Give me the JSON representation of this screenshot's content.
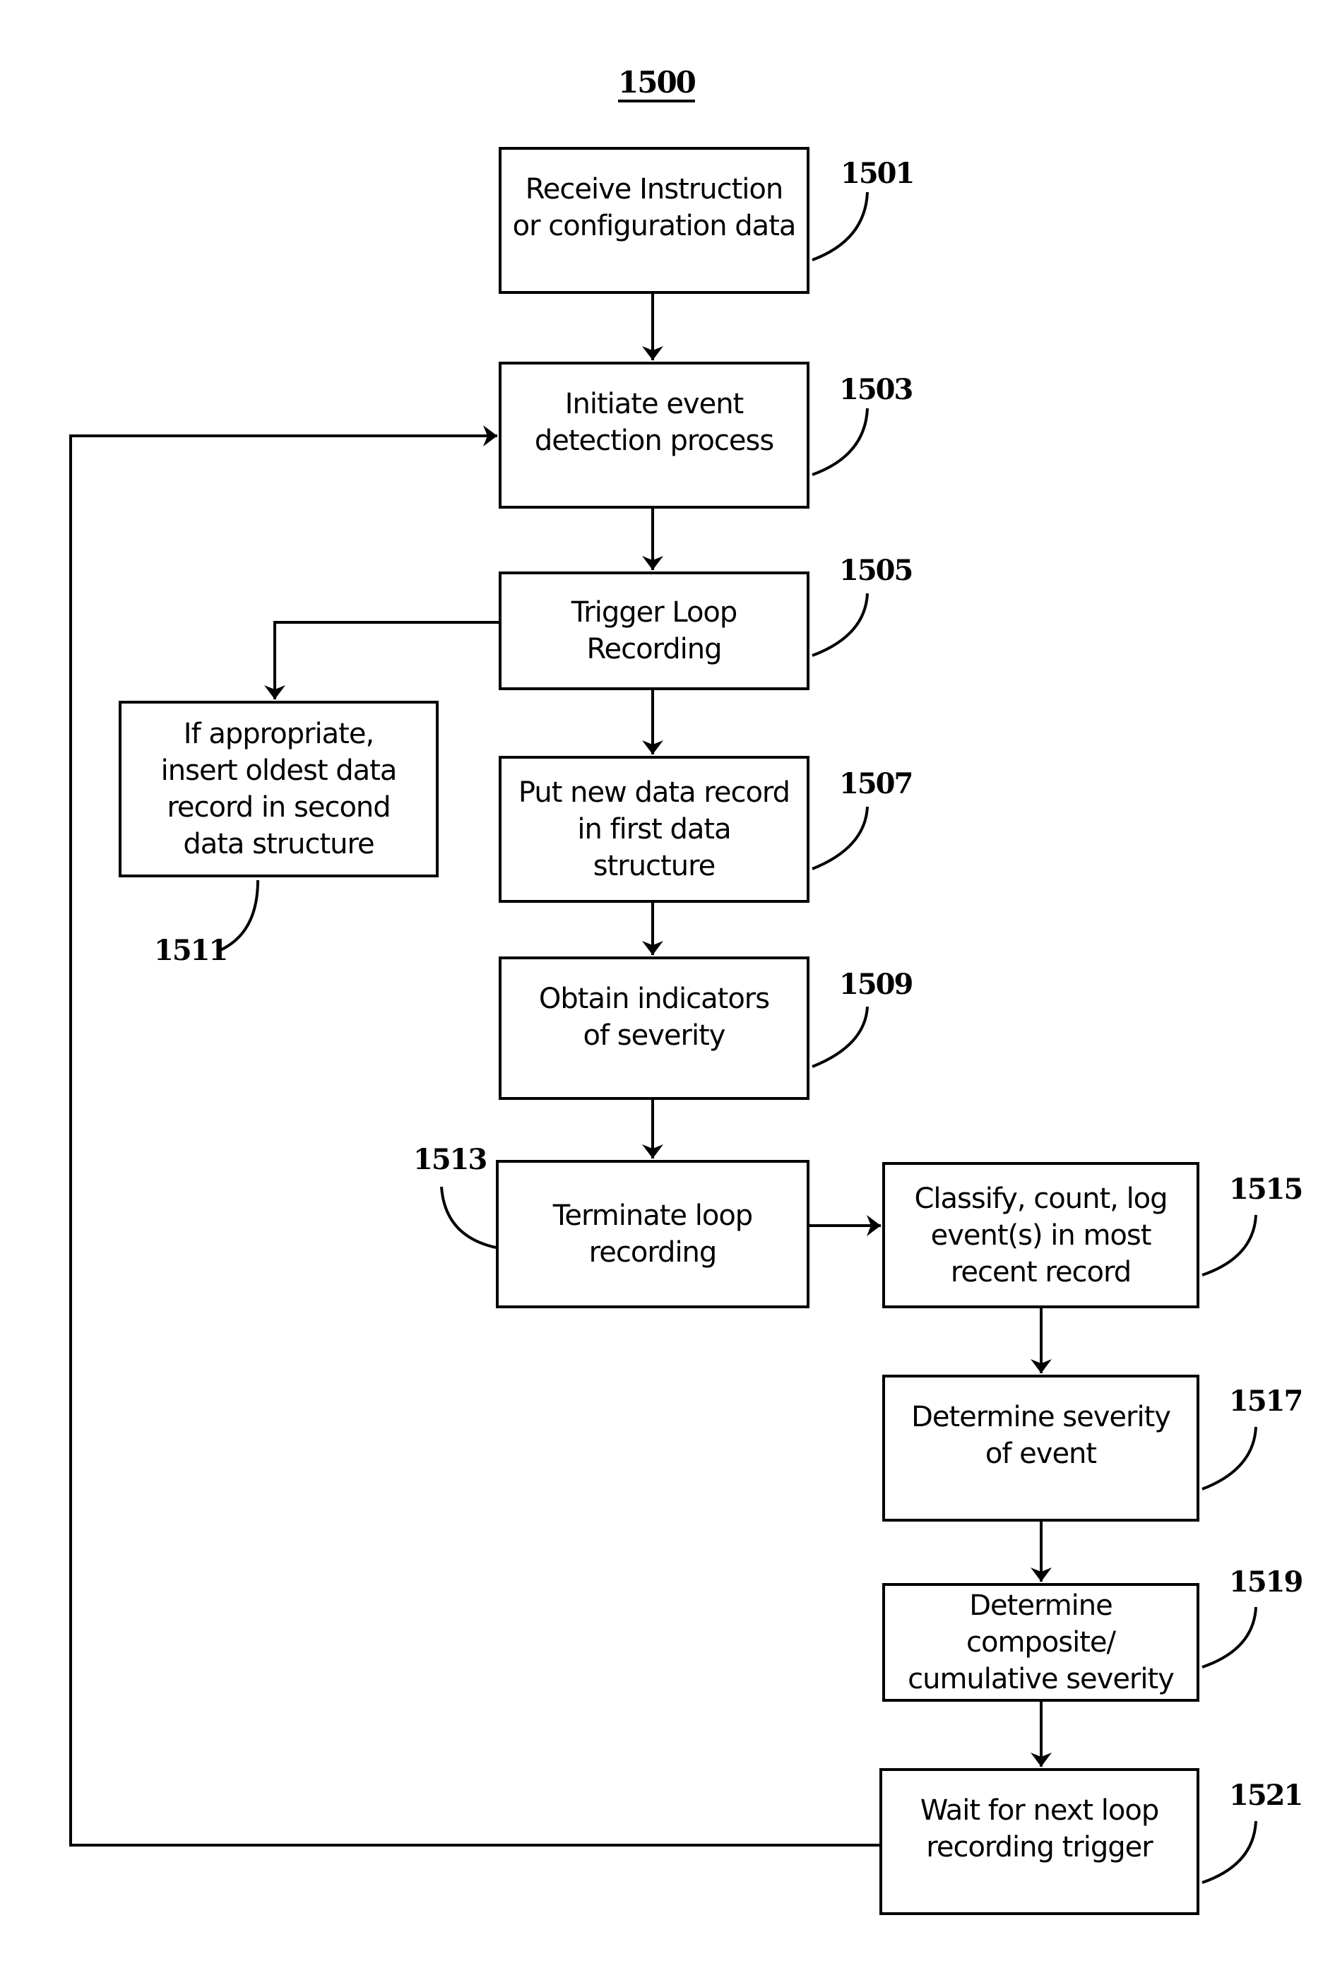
{
  "figure": {
    "number": "1500",
    "steps": [
      {
        "id": "1501",
        "text": "Receive Instruction or configuration data"
      },
      {
        "id": "1503",
        "text": "Initiate event detection process"
      },
      {
        "id": "1505",
        "text": "Trigger Loop Recording"
      },
      {
        "id": "1507",
        "text": "Put new data record in first data structure"
      },
      {
        "id": "1509",
        "text": "Obtain indicators of severity"
      },
      {
        "id": "1511",
        "text": "If appropriate, insert oldest data record in second data structure"
      },
      {
        "id": "1513",
        "text": "Terminate loop recording"
      },
      {
        "id": "1515",
        "text": "Classify, count, log event(s) in most recent record"
      },
      {
        "id": "1517",
        "text": "Determine severity of event"
      },
      {
        "id": "1519",
        "text": "Determine composite/ cumulative severity"
      },
      {
        "id": "1521",
        "text": "Wait for next loop recording trigger"
      }
    ],
    "edges": [
      [
        "1501",
        "1503"
      ],
      [
        "1503",
        "1505"
      ],
      [
        "1505",
        "1507"
      ],
      [
        "1505",
        "1511"
      ],
      [
        "1507",
        "1509"
      ],
      [
        "1509",
        "1513"
      ],
      [
        "1513",
        "1515"
      ],
      [
        "1515",
        "1517"
      ],
      [
        "1517",
        "1519"
      ],
      [
        "1519",
        "1521"
      ],
      [
        "1521",
        "1503"
      ]
    ]
  }
}
